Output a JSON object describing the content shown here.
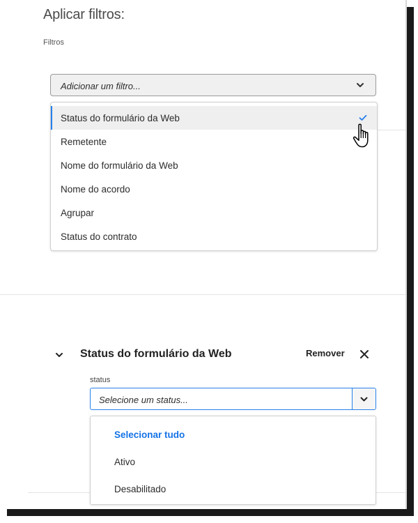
{
  "header": {
    "title": "Aplicar filtros:",
    "filters_label": "Filtros"
  },
  "filter_picker": {
    "placeholder": "Adicionar um filtro...",
    "icon": "chevron-down-icon"
  },
  "filter_menu": {
    "items": [
      {
        "label": "Status do formulário da Web",
        "selected": true
      },
      {
        "label": "Remetente",
        "selected": false
      },
      {
        "label": "Nome do formulário da Web",
        "selected": false
      },
      {
        "label": "Nome do acordo",
        "selected": false
      },
      {
        "label": "Agrupar",
        "selected": false
      },
      {
        "label": "Status do contrato",
        "selected": false
      }
    ],
    "selected_icon": "checkmark-icon",
    "accent": "#2680eb"
  },
  "active_filter": {
    "title": "Status do formulário da Web",
    "remove_label": "Remover",
    "field_label": "status",
    "select_placeholder": "Selecione um status...",
    "options": [
      {
        "label": "Selecionar tudo",
        "highlight": true
      },
      {
        "label": "Ativo",
        "highlight": false
      },
      {
        "label": "Desabilitado",
        "highlight": false
      }
    ],
    "highlight_color": "#1473e6"
  }
}
